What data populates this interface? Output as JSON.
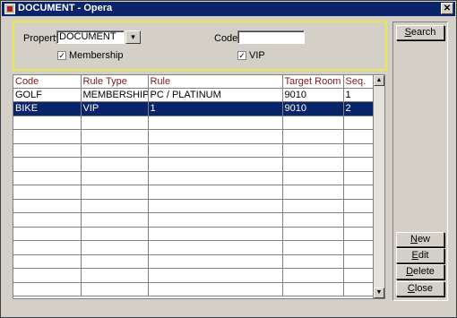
{
  "window": {
    "title": "DOCUMENT - Opera",
    "close_label": "✕"
  },
  "filter": {
    "property_label": "Property",
    "property_value": "DOCUMENT",
    "code_label": "Code",
    "code_value": "",
    "membership_label": "Membership",
    "membership_checked": true,
    "vip_label": "VIP",
    "vip_checked": true
  },
  "buttons": {
    "search": {
      "acc": "S",
      "rest": "earch"
    },
    "new": {
      "acc": "N",
      "rest": "ew"
    },
    "edit": {
      "acc": "E",
      "rest": "dit"
    },
    "delete": {
      "acc": "D",
      "rest": "elete"
    },
    "close": {
      "acc": "C",
      "rest": "lose"
    }
  },
  "grid": {
    "columns": [
      "Code",
      "Rule Type",
      "Rule",
      "Target Room",
      "Seq."
    ],
    "rows": [
      [
        "GOLF",
        "MEMBERSHIP",
        "PC / PLATINUM",
        "9010",
        "1"
      ],
      [
        "BIKE",
        "VIP",
        "1",
        "9010",
        "2"
      ],
      [
        "",
        "",
        "",
        "",
        ""
      ],
      [
        "",
        "",
        "",
        "",
        ""
      ],
      [
        "",
        "",
        "",
        "",
        ""
      ],
      [
        "",
        "",
        "",
        "",
        ""
      ],
      [
        "",
        "",
        "",
        "",
        ""
      ],
      [
        "",
        "",
        "",
        "",
        ""
      ],
      [
        "",
        "",
        "",
        "",
        ""
      ],
      [
        "",
        "",
        "",
        "",
        ""
      ],
      [
        "",
        "",
        "",
        "",
        ""
      ],
      [
        "",
        "",
        "",
        "",
        ""
      ],
      [
        "",
        "",
        "",
        "",
        ""
      ],
      [
        "",
        "",
        "",
        "",
        ""
      ],
      [
        "",
        "",
        "",
        "",
        ""
      ]
    ],
    "selected_row": 1
  },
  "icons": {
    "lov_arrow": "▾",
    "scroll_up": "▲",
    "scroll_down": "▼",
    "check": "✓"
  },
  "colors": {
    "title_bar": "#0a246a",
    "selection": "#0a246a",
    "filter_border": "#e8e84a",
    "header_text": "#7a1a1a"
  }
}
